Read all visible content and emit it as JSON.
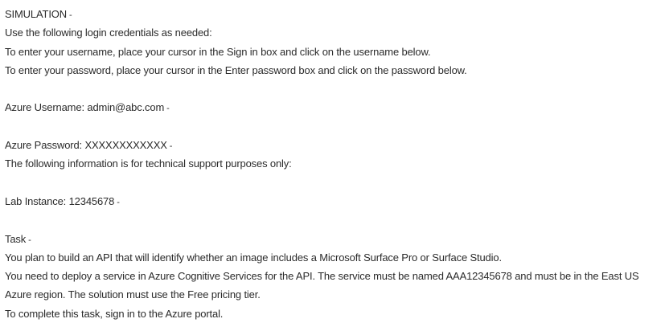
{
  "simulation": {
    "heading": "SIMULATION",
    "heading_marker": "-"
  },
  "credentials": {
    "intro": "Use the following login credentials as needed:",
    "username_instruction": "To enter your username, place your cursor in the Sign in box and click on the username below.",
    "password_instruction": "To enter your password, place your cursor in the Enter password box and click on the password below.",
    "username_label": "Azure Username:",
    "username_value": "admin@abc.com",
    "username_marker": "-",
    "password_label": "Azure Password:",
    "password_value": "XXXXXXXXXXXX",
    "password_marker": "-"
  },
  "support": {
    "note": "The following information is for technical support purposes only:",
    "lab_instance_label": "Lab Instance:",
    "lab_instance_value": "12345678",
    "lab_instance_marker": "-"
  },
  "task": {
    "heading": "Task",
    "heading_marker": "-",
    "line1": "You plan to build an API that will identify whether an image includes a Microsoft Surface Pro or Surface Studio.",
    "line2": "You need to deploy a service in Azure Cognitive Services for the API. The service must be named AAA12345678 and must be in the East US Azure region. The solution must use the Free pricing tier.",
    "line3": "To complete this task, sign in to the Azure portal."
  }
}
